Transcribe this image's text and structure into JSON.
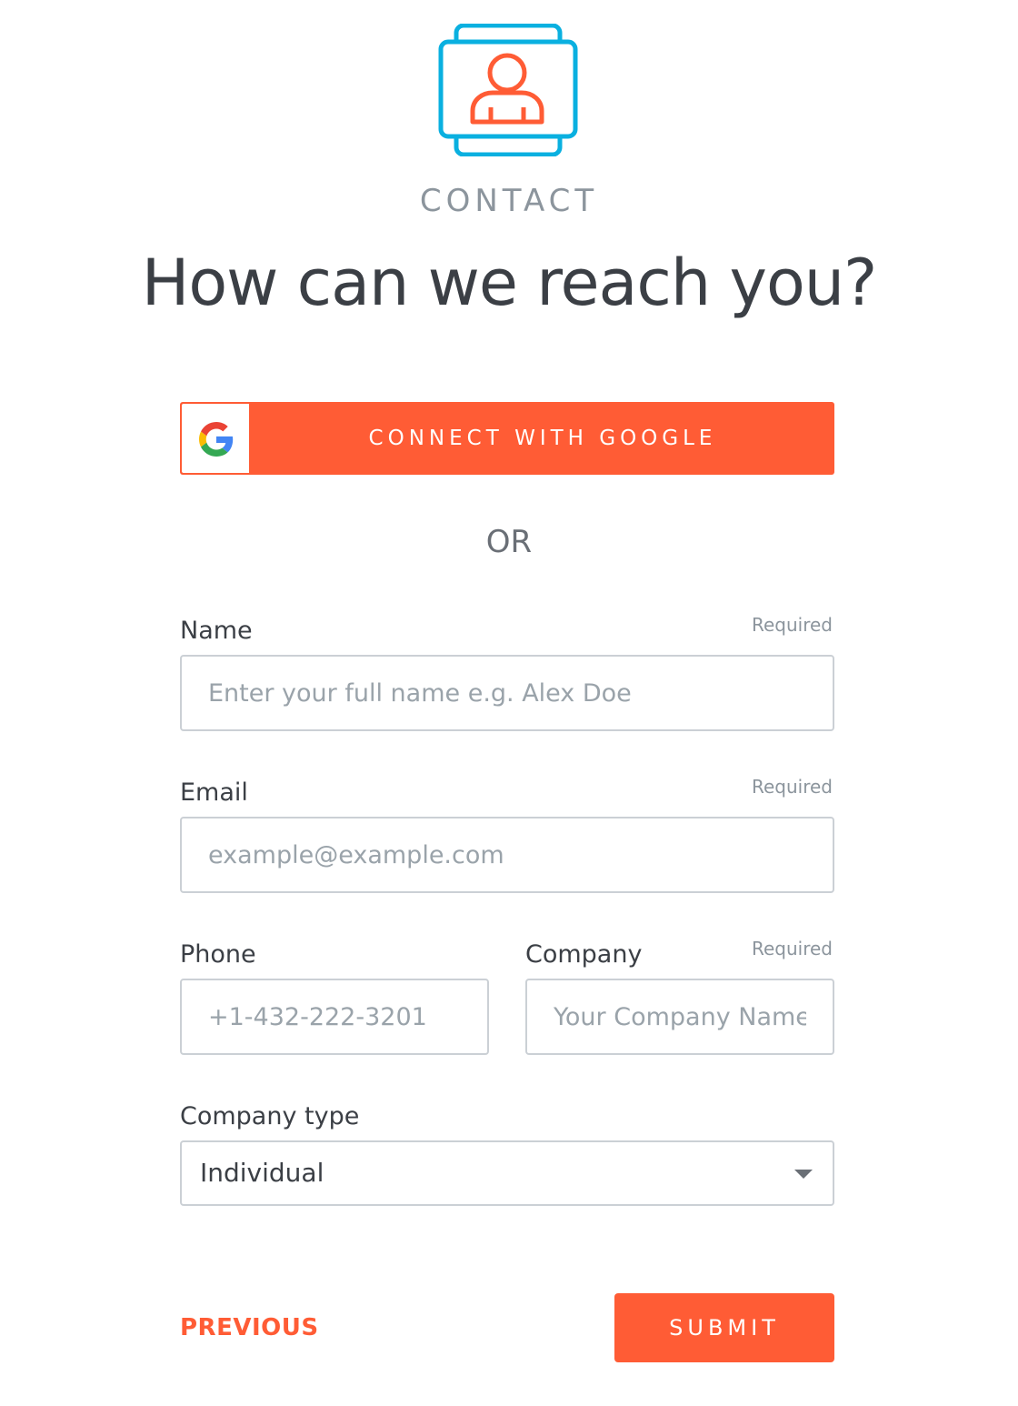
{
  "header": {
    "eyebrow": "CONTACT",
    "title": "How can we reach you?",
    "icon": "contact-card-icon"
  },
  "google_button": {
    "label": "CONNECT WITH GOOGLE",
    "icon": "google-g-icon"
  },
  "divider": {
    "label": "OR"
  },
  "form": {
    "name": {
      "label": "Name",
      "required_text": "Required",
      "value": "",
      "placeholder": "Enter your full name e.g. Alex Doe"
    },
    "email": {
      "label": "Email",
      "required_text": "Required",
      "value": "",
      "placeholder": "example@example.com"
    },
    "phone": {
      "label": "Phone",
      "value": "",
      "placeholder": "+1-432-222-3201"
    },
    "company": {
      "label": "Company",
      "required_text": "Required",
      "value": "",
      "placeholder": "Your Company Name"
    },
    "company_type": {
      "label": "Company type",
      "selected": "Individual"
    }
  },
  "footer": {
    "previous_label": "PREVIOUS",
    "submit_label": "SUBMIT"
  },
  "colors": {
    "accent": "#ff5c35",
    "icon_blue": "#0ab0e0",
    "muted_text": "#8c959d",
    "border": "#cbd0d5"
  }
}
